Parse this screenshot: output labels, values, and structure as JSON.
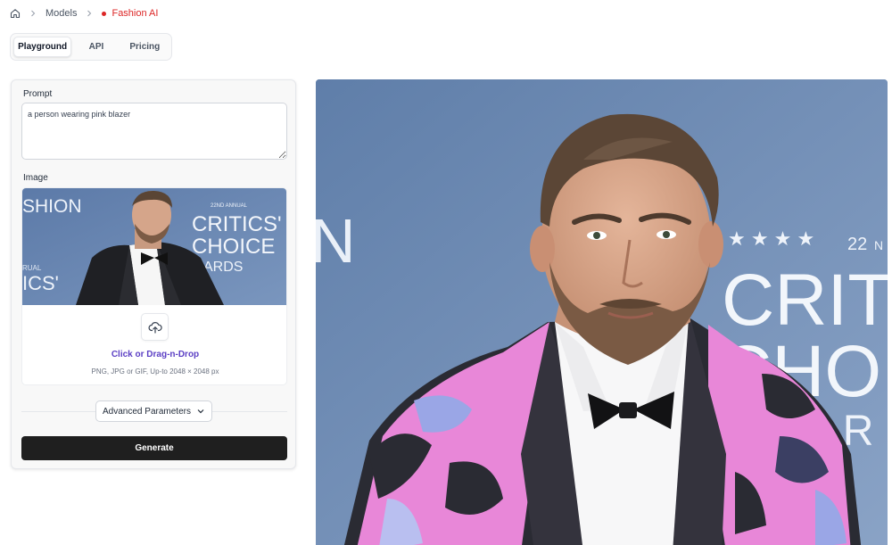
{
  "breadcrumb": {
    "home_icon": "home-icon",
    "models": "Models",
    "current": "Fashion AI",
    "current_color": "#dc2626"
  },
  "tabs": [
    {
      "label": "Playground",
      "active": true
    },
    {
      "label": "API",
      "active": false
    },
    {
      "label": "Pricing",
      "active": false
    }
  ],
  "form": {
    "prompt_label": "Prompt",
    "prompt_value": "a person wearing pink blazer",
    "image_label": "Image",
    "upload_icon": "cloud-upload-icon",
    "upload_cta": "Click or Drag-n-Drop",
    "upload_hint": "PNG, JPG or GIF, Up-to 2048 × 2048 px",
    "advanced_label": "Advanced Parameters",
    "generate_label": "Generate"
  },
  "thumbnail": {
    "backdrop_text_left": "SHION",
    "backdrop_text_left2": "RUAL",
    "backdrop_text_left3": "ICS'",
    "backdrop_text_right1": "22ND ANNUAL",
    "backdrop_text_right2": "CRITICS'",
    "backdrop_text_right3": "CHOICE",
    "backdrop_text_right4": "ARDS"
  },
  "output": {
    "backdrop_text_left": "N",
    "backdrop_stars": "★ ★ ★ ★",
    "backdrop_text_22": "22",
    "backdrop_text_n": "N",
    "backdrop_text_1": "CRITI",
    "backdrop_text_2": "CHOI",
    "backdrop_text_3": "A R"
  },
  "colors": {
    "backdrop_blue": "#6f8cb5",
    "blazer_pink": "#e887d8",
    "accent_purple": "#5b3fc4",
    "generate_bg": "#1f1f1f"
  }
}
